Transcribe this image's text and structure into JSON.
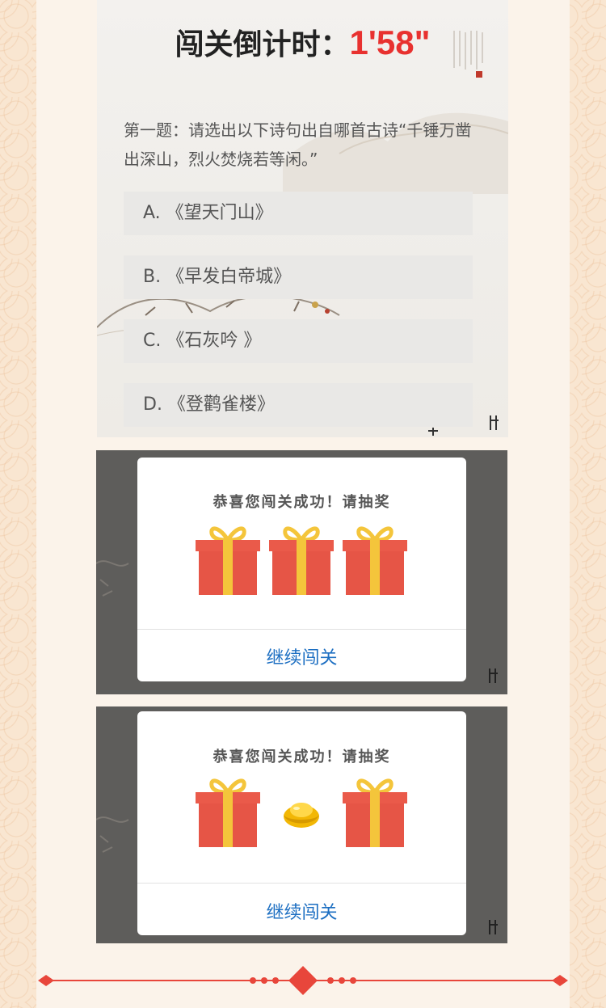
{
  "quiz": {
    "timer_label": "闯关倒计时：",
    "timer_value": "1'58\"",
    "question": "第一题：请选出以下诗句出自哪首古诗“千锤万凿出深山，烈火焚烧若等闲。”",
    "options": [
      {
        "label": "A. 《望天门山》"
      },
      {
        "label": "B. 《早发白帝城》"
      },
      {
        "label": "C. 《石灰吟 》"
      },
      {
        "label": "D. 《登鹳雀楼》"
      }
    ]
  },
  "dialog_all_gifts": {
    "title": "恭喜您闯关成功！请抽奖",
    "button": "继续闯关",
    "prizes": [
      "gift-box-icon",
      "gift-box-icon",
      "gift-box-icon"
    ]
  },
  "dialog_revealed": {
    "title": "恭喜您闯关成功！请抽奖",
    "button": "继续闯关",
    "prizes": [
      "gift-box-icon",
      "gold-ingot-icon",
      "gift-box-icon"
    ]
  },
  "colors": {
    "timer": "#e8312f",
    "gift_box": "#ea5a4a",
    "gift_ribbon": "#f4c53b",
    "link": "#1d6fc2",
    "ornament": "#e8463b"
  }
}
